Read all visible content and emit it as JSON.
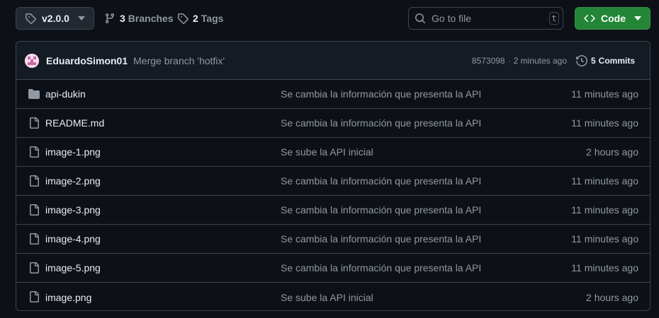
{
  "toolbar": {
    "branch": "v2.0.0",
    "branches_count": "3",
    "branches_label": "Branches",
    "tags_count": "2",
    "tags_label": "Tags",
    "search_placeholder": "Go to file",
    "search_shortcut": "t",
    "code_label": "Code"
  },
  "latest_commit": {
    "author": "EduardoSimon01",
    "message": "Merge branch 'hotfix'",
    "sha": "8573098",
    "separator": "·",
    "time": "2 minutes ago",
    "commits_count": "5",
    "commits_label": "Commits"
  },
  "files": [
    {
      "name": "api-dukin",
      "type": "folder",
      "message": "Se cambia la información que presenta la API",
      "time": "11 minutes ago"
    },
    {
      "name": "README.md",
      "type": "file",
      "message": "Se cambia la información que presenta la API",
      "time": "11 minutes ago"
    },
    {
      "name": "image-1.png",
      "type": "file",
      "message": "Se sube la API inicial",
      "time": "2 hours ago"
    },
    {
      "name": "image-2.png",
      "type": "file",
      "message": "Se cambia la información que presenta la API",
      "time": "11 minutes ago"
    },
    {
      "name": "image-3.png",
      "type": "file",
      "message": "Se cambia la información que presenta la API",
      "time": "11 minutes ago"
    },
    {
      "name": "image-4.png",
      "type": "file",
      "message": "Se cambia la información que presenta la API",
      "time": "11 minutes ago"
    },
    {
      "name": "image-5.png",
      "type": "file",
      "message": "Se cambia la información que presenta la API",
      "time": "11 minutes ago"
    },
    {
      "name": "image.png",
      "type": "file",
      "message": "Se sube la API inicial",
      "time": "2 hours ago"
    }
  ],
  "colors": {
    "background": "#0d1117",
    "border": "#3d444d",
    "muted_text": "#9198a1",
    "primary_text": "#e6edf3",
    "code_button": "#238636"
  },
  "icons": [
    "tag-icon",
    "chevron-down-icon",
    "git-branch-icon",
    "search-icon",
    "code-icon",
    "history-icon",
    "folder-icon",
    "file-icon"
  ]
}
